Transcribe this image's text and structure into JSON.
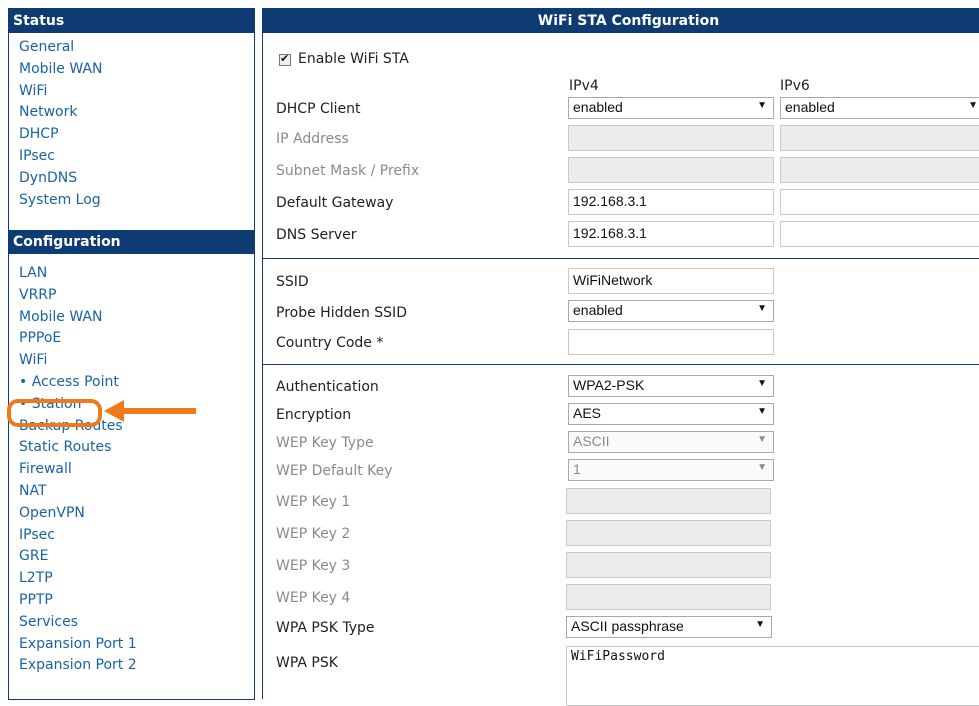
{
  "sidebar": {
    "status_title": "Status",
    "status_items": [
      "General",
      "Mobile WAN",
      "WiFi",
      "Network",
      "DHCP",
      "IPsec",
      "DynDNS",
      "System Log"
    ],
    "config_title": "Configuration",
    "config_items": [
      "LAN",
      "VRRP",
      "Mobile WAN",
      "PPPoE",
      "WiFi",
      "• Access Point",
      "• Station",
      "Backup Routes",
      "Static Routes",
      "Firewall",
      "NAT",
      "OpenVPN",
      "IPsec",
      "GRE",
      "L2TP",
      "PPTP",
      "Services",
      "Expansion Port 1",
      "Expansion Port 2"
    ]
  },
  "main": {
    "title": "WiFi STA Configuration",
    "enable_label": "Enable WiFi STA",
    "ipv4_header": "IPv4",
    "ipv6_header": "IPv6",
    "dhcp_label": "DHCP Client",
    "dhcp_ipv4": "enabled",
    "dhcp_ipv6": "enabled",
    "ip_label": "IP Address",
    "subnet_label": "Subnet Mask / Prefix",
    "gateway_label": "Default Gateway",
    "gateway_ipv4": "192.168.3.1",
    "dns_label": "DNS Server",
    "dns_ipv4": "192.168.3.1",
    "ssid_label": "SSID",
    "ssid_value": "WiFiNetwork",
    "probe_label": "Probe Hidden SSID",
    "probe_value": "enabled",
    "country_label": "Country Code *",
    "auth_label": "Authentication",
    "auth_value": "WPA2-PSK",
    "enc_label": "Encryption",
    "enc_value": "AES",
    "wep_type_label": "WEP Key Type",
    "wep_type_value": "ASCII",
    "wep_default_label": "WEP Default Key",
    "wep_default_value": "1",
    "wep1_label": "WEP Key 1",
    "wep2_label": "WEP Key 2",
    "wep3_label": "WEP Key 3",
    "wep4_label": "WEP Key 4",
    "psk_type_label": "WPA PSK Type",
    "psk_type_value": "ASCII passphrase",
    "psk_label": "WPA PSK",
    "psk_value": "WiFiPassword"
  },
  "colors": {
    "header_bg": "#0f3b73",
    "link": "#1763a8",
    "annotation": "#f07a1a"
  }
}
